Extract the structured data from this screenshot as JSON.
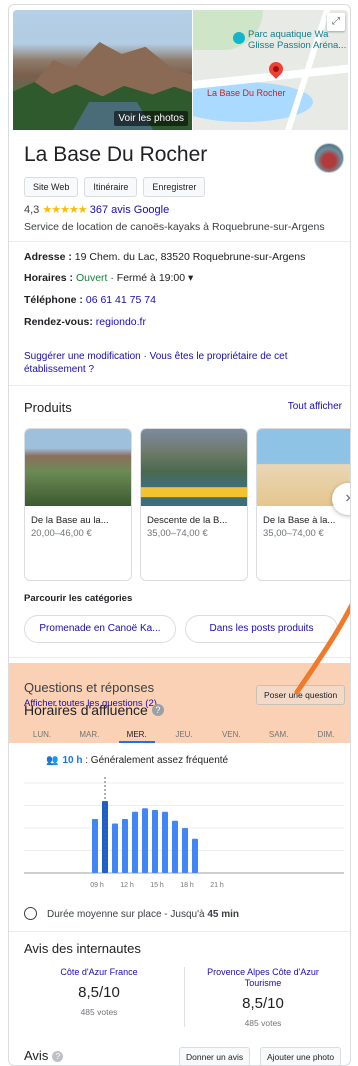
{
  "media": {
    "photos_label": "Voir les photos",
    "map_poi": "Parc aquatique Wa Glisse Passion Aréna...",
    "map_place": "La Base Du Rocher"
  },
  "header": {
    "title": "La Base Du Rocher",
    "buttons": [
      "Site Web",
      "Itinéraire",
      "Enregistrer"
    ]
  },
  "rating": {
    "value": "4,3",
    "stars": "★★★★★",
    "reviews_link": "367 avis Google"
  },
  "category": "Service de location de canoës-kayaks à Roquebrune-sur-Argens",
  "info": {
    "address_label": "Adresse",
    "address_value": "19 Chem. du Lac, 83520 Roquebrune-sur-Argens",
    "hours_label": "Horaires",
    "hours_open": "Ouvert",
    "hours_rest": "· Fermé à 19:00 ▾",
    "phone_label": "Téléphone",
    "phone_value": "06 61 41 75 74",
    "booking_label": "Rendez-vous",
    "booking_value": "regiondo.fr",
    "suggest": "Suggérer une modification · Vous êtes le propriétaire de cet établissement ?"
  },
  "products": {
    "title": "Produits",
    "show_all": "Tout afficher",
    "items": [
      {
        "name": "De la Base au la...",
        "price": "20,00–46,00 €"
      },
      {
        "name": "Descente de la B...",
        "price": "35,00–74,00 €"
      },
      {
        "name": "De la Base à la...",
        "price": "35,00–74,00 €"
      }
    ],
    "next_arrow": "›"
  },
  "browse": {
    "title": "Parcourir les catégories",
    "chips": [
      "Promenade en Canoë Ka...",
      "Dans les posts produits"
    ]
  },
  "qa": {
    "title": "Questions et réponses",
    "link": "Afficher toutes les questions (2)",
    "ask_button": "Poser une question"
  },
  "popular_times": {
    "title": "Horaires d'affluence",
    "help": "?",
    "days": [
      "LUN.",
      "MAR.",
      "MER.",
      "JEU.",
      "VEN.",
      "SAM.",
      "DIM."
    ],
    "active_day": "MER.",
    "live_hour": "10 h",
    "live_text": ": Généralement assez fréquenté",
    "duration_text": "Durée moyenne sur place - Jusqu'à",
    "duration_value": "45 min"
  },
  "chart_data": {
    "type": "bar",
    "categories": [
      "8h",
      "9h",
      "10h",
      "11h",
      "12h",
      "13h",
      "14h",
      "15h",
      "16h",
      "17h",
      "18h",
      "19h"
    ],
    "x_tick_labels": [
      "09 h",
      "12 h",
      "15 h",
      "18 h",
      "21 h"
    ],
    "values": [
      0,
      60,
      80,
      55,
      60,
      68,
      72,
      70,
      68,
      58,
      50,
      38
    ],
    "ylim": [
      0,
      100
    ],
    "live_index": 2,
    "grid": true,
    "bar_color": "#4285f4"
  },
  "reviews_web": {
    "title": "Avis des internautes",
    "sites": [
      {
        "name": "Côte d'Azur France",
        "score": "8,5/10",
        "votes": "485 votes"
      },
      {
        "name": "Provence Alpes Côte d'Azur Tourisme",
        "score": "8,5/10",
        "votes": "485 votes"
      }
    ]
  },
  "reviews": {
    "title": "Avis",
    "help": "?",
    "write_button": "Donner un avis",
    "photo_button": "Ajouter une photo"
  },
  "colors": {
    "link": "#1a0dab",
    "open": "#188038",
    "star": "#fbbc04",
    "highlight": "#f7ac78",
    "bar": "#4285f4"
  }
}
